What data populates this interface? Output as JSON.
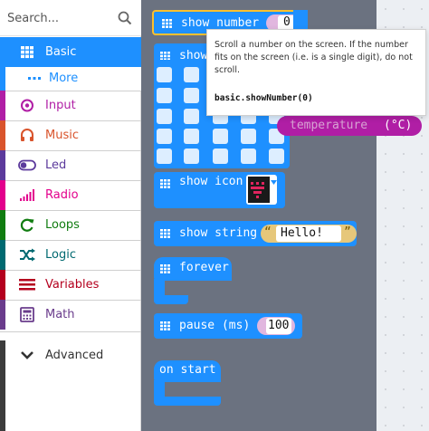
{
  "search": {
    "placeholder": "Search..."
  },
  "categories": [
    {
      "id": "basic",
      "label": "Basic",
      "color": "#1e90ff",
      "icon": "grid-icon"
    },
    {
      "id": "more",
      "label": "More",
      "color": "#1e90ff",
      "icon": "ellipsis-icon"
    },
    {
      "id": "input",
      "label": "Input",
      "color": "#b01ea5",
      "icon": "target-icon"
    },
    {
      "id": "music",
      "label": "Music",
      "color": "#d9542c",
      "icon": "headphones-icon"
    },
    {
      "id": "led",
      "label": "Led",
      "color": "#5c3a9c",
      "icon": "toggle-icon"
    },
    {
      "id": "radio",
      "label": "Radio",
      "color": "#e3008c",
      "icon": "signal-bars-icon"
    },
    {
      "id": "loops",
      "label": "Loops",
      "color": "#107c10",
      "icon": "refresh-icon"
    },
    {
      "id": "logic",
      "label": "Logic",
      "color": "#006970",
      "icon": "shuffle-icon"
    },
    {
      "id": "variables",
      "label": "Variables",
      "color": "#b4001e",
      "icon": "list-icon"
    },
    {
      "id": "math",
      "label": "Math",
      "color": "#6a3c8c",
      "icon": "calculator-icon"
    },
    {
      "id": "advanced",
      "label": "Advanced",
      "color": "#3c3c3c",
      "icon": "chevron-down-icon"
    }
  ],
  "blocks": {
    "show_number": {
      "label": "show number",
      "value": "0"
    },
    "show_leds": {
      "label": "show leds"
    },
    "show_icon": {
      "label": "show icon"
    },
    "show_string": {
      "label": "show string",
      "value": "Hello!"
    },
    "forever": {
      "label": "forever"
    },
    "pause": {
      "label": "pause (ms)",
      "value": "100"
    },
    "on_start": {
      "label": "on start"
    },
    "temperature_fragment": {
      "label": "temperature",
      "unit": "(°C)"
    }
  },
  "tooltip": {
    "description": "Scroll a number on the screen. If the number fits on the screen (i.e. is a single digit), do not scroll.",
    "code": "basic.showNumber(0)"
  }
}
